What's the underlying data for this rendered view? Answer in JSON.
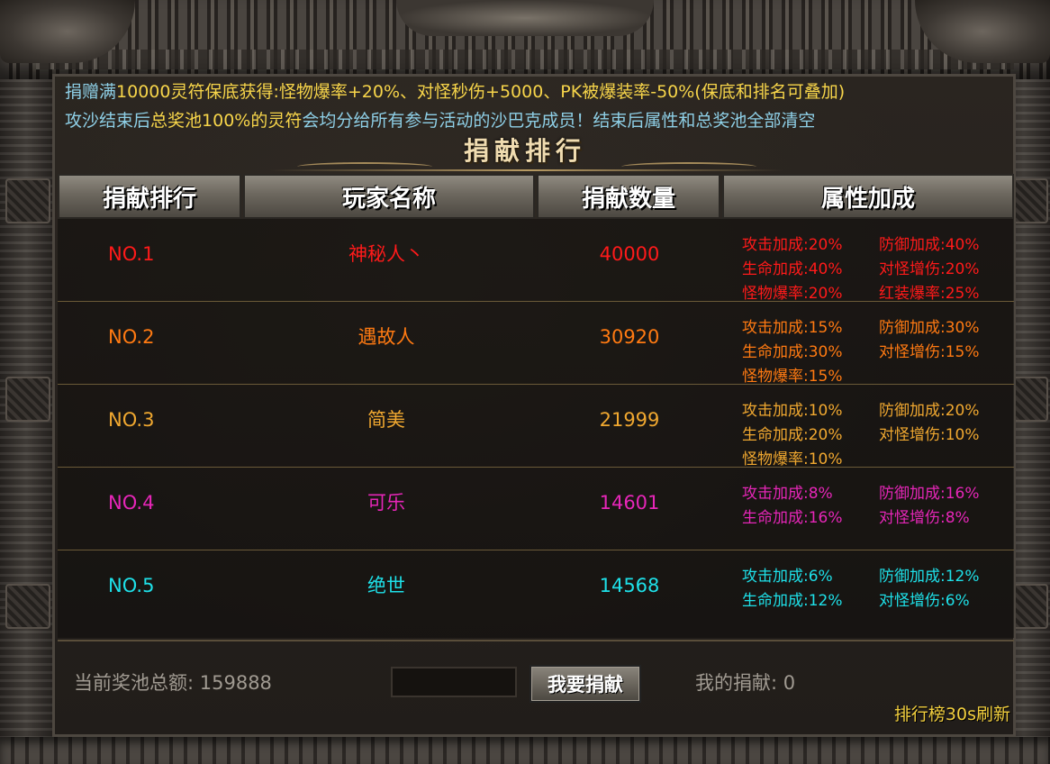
{
  "notice": {
    "line1_part1": "捐赠满",
    "line1_part2": "10000灵符保底获得",
    "line1_part3": ":怪物爆率+20%、对怪秒伤+5000、PK被爆装率-50%(保底和排名可叠加)",
    "line2_part1": "攻沙结束后",
    "line2_part2": "总奖池100%的灵符",
    "line2_part3": "会均分给所有参与活动的沙巴克成员！结束后属性和总奖池全部清空"
  },
  "title": "捐献排行",
  "table": {
    "headers": [
      "捐献排行",
      "玩家名称",
      "捐献数量",
      "属性加成"
    ],
    "rows": [
      {
        "rank": "NO.1",
        "name": "神秘人丶",
        "amount": "40000",
        "color": "#ff1a1a",
        "attrs": [
          [
            "攻击加成:20%",
            "防御加成:40%"
          ],
          [
            "生命加成:40%",
            "对怪增伤:20%"
          ],
          [
            "怪物爆率:20%",
            "红装爆率:25%"
          ]
        ]
      },
      {
        "rank": "NO.2",
        "name": "遇故人",
        "amount": "30920",
        "color": "#ff7a12",
        "attrs": [
          [
            "攻击加成:15%",
            "防御加成:30%"
          ],
          [
            "生命加成:30%",
            "对怪增伤:15%"
          ],
          [
            "怪物爆率:15%",
            ""
          ]
        ]
      },
      {
        "rank": "NO.3",
        "name": "简美",
        "amount": "21999",
        "color": "#f0a830",
        "attrs": [
          [
            "攻击加成:10%",
            "防御加成:20%"
          ],
          [
            "生命加成:20%",
            "对怪增伤:10%"
          ],
          [
            "怪物爆率:10%",
            ""
          ]
        ]
      },
      {
        "rank": "NO.4",
        "name": "可乐",
        "amount": "14601",
        "color": "#e626b8",
        "attrs": [
          [
            "攻击加成:8%",
            "防御加成:16%"
          ],
          [
            "生命加成:16%",
            "对怪增伤:8%"
          ]
        ]
      },
      {
        "rank": "NO.5",
        "name": "绝世",
        "amount": "14568",
        "color": "#1ee0e8",
        "attrs": [
          [
            "攻击加成:6%",
            "防御加成:12%"
          ],
          [
            "生命加成:12%",
            "对怪增伤:6%"
          ]
        ]
      }
    ]
  },
  "footer": {
    "pool_label": "当前奖池总额: 159888",
    "donate_input_value": "",
    "donate_button": "我要捐献",
    "my_donation": "我的捐献: 0",
    "refresh_note": "排行榜30s刷新"
  }
}
